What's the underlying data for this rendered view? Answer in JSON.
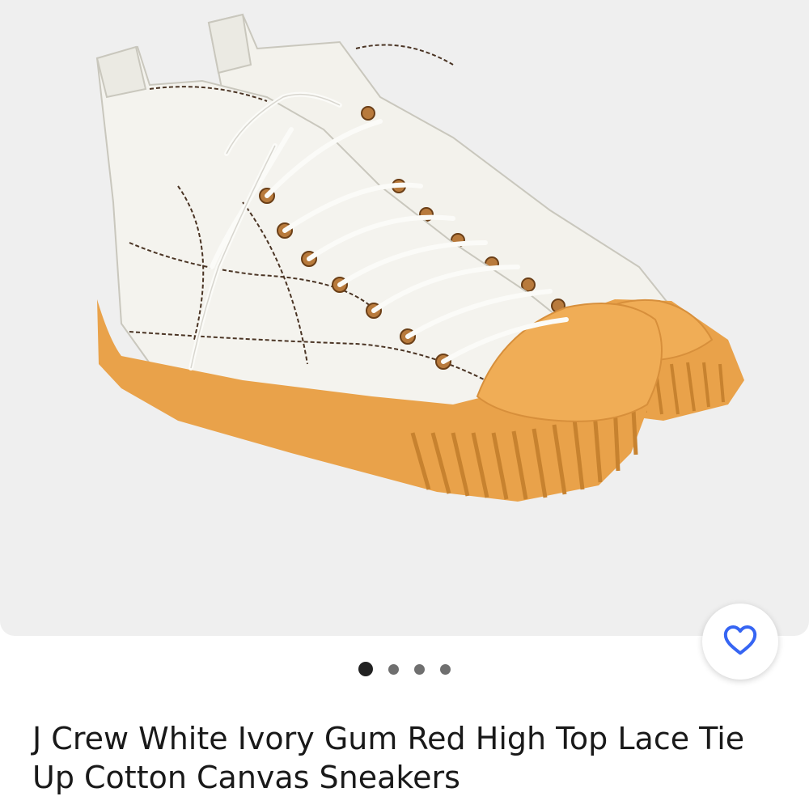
{
  "product": {
    "title": "J Crew White Ivory Gum Red High Top Lace Tie Up Cotton Canvas Sneakers",
    "image_alt": "White canvas high top sneakers with gum rubber sole"
  },
  "gallery": {
    "image_count": 4,
    "active_index": 0
  },
  "icons": {
    "favorite": "heart-icon"
  },
  "colors": {
    "accent": "#3665f3",
    "canvas": "#f4f3ee",
    "gum_sole": "#e9a24a",
    "panel_bg": "#efefef"
  }
}
